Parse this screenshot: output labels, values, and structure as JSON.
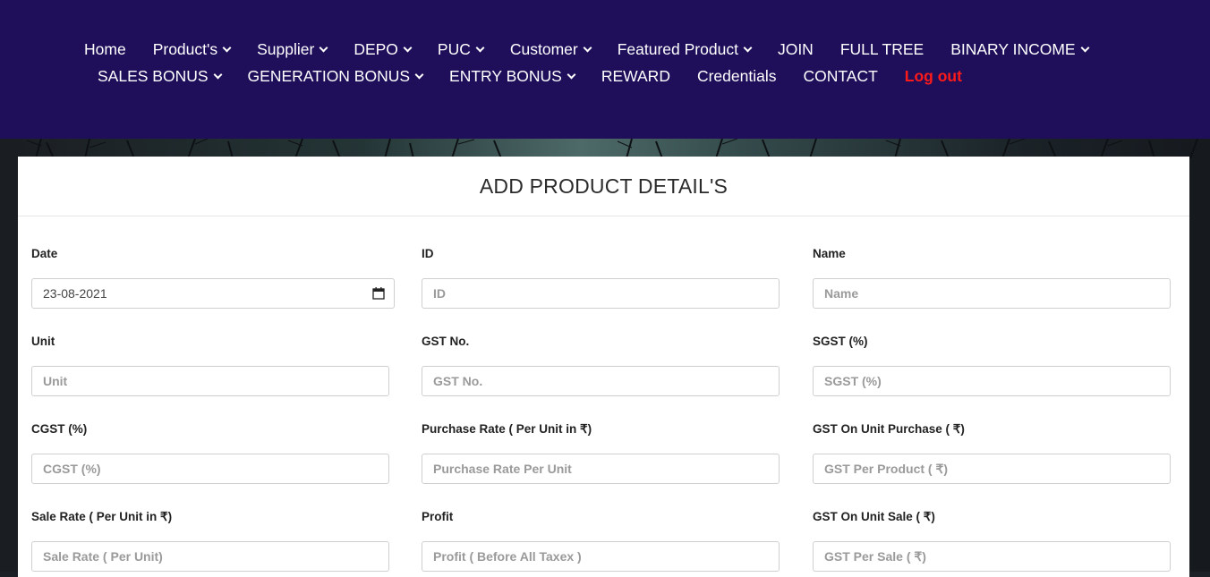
{
  "nav": {
    "row1": [
      {
        "label": "Home",
        "dropdown": false
      },
      {
        "label": "Product's",
        "dropdown": true
      },
      {
        "label": "Supplier",
        "dropdown": true
      },
      {
        "label": "DEPO",
        "dropdown": true
      },
      {
        "label": "PUC",
        "dropdown": true
      },
      {
        "label": "Customer",
        "dropdown": true
      },
      {
        "label": "Featured Product",
        "dropdown": true
      },
      {
        "label": "JOIN",
        "dropdown": false
      },
      {
        "label": "FULL TREE",
        "dropdown": false
      },
      {
        "label": "BINARY INCOME",
        "dropdown": true
      }
    ],
    "row2": [
      {
        "label": "SALES BONUS",
        "dropdown": true
      },
      {
        "label": "GENERATION BONUS",
        "dropdown": true
      },
      {
        "label": "ENTRY BONUS",
        "dropdown": true
      },
      {
        "label": "REWARD",
        "dropdown": false
      },
      {
        "label": "Credentials",
        "dropdown": false
      },
      {
        "label": "CONTACT",
        "dropdown": false
      },
      {
        "label": "Log out",
        "dropdown": false,
        "accent": "#ff1a1a"
      }
    ]
  },
  "form": {
    "title": "ADD PRODUCT DETAIL'S",
    "fields": {
      "date": {
        "label": "Date",
        "value": "23-08-2021"
      },
      "id": {
        "label": "ID",
        "placeholder": "ID"
      },
      "name": {
        "label": "Name",
        "placeholder": "Name"
      },
      "unit": {
        "label": "Unit",
        "placeholder": "Unit"
      },
      "gst_no": {
        "label": "GST No.",
        "placeholder": "GST No."
      },
      "sgst": {
        "label": "SGST (%)",
        "placeholder": "SGST (%)"
      },
      "cgst": {
        "label": "CGST (%)",
        "placeholder": "CGST (%)"
      },
      "purchase_rate": {
        "label": "Purchase Rate ( Per Unit in ₹)",
        "placeholder": "Purchase Rate Per Unit"
      },
      "gst_unit_purchase": {
        "label": "GST On Unit Purchase ( ₹)",
        "placeholder": "GST Per Product ( ₹)"
      },
      "sale_rate": {
        "label": "Sale Rate ( Per Unit in ₹)",
        "placeholder": "Sale Rate ( Per Unit)"
      },
      "profit": {
        "label": "Profit",
        "placeholder": "Profit ( Before All Taxex )"
      },
      "gst_unit_sale": {
        "label": "GST On Unit Sale ( ₹)",
        "placeholder": "GST Per Sale ( ₹)"
      }
    }
  },
  "colors": {
    "navbar": "#1f0f5b",
    "logout": "#ff1a1a"
  }
}
